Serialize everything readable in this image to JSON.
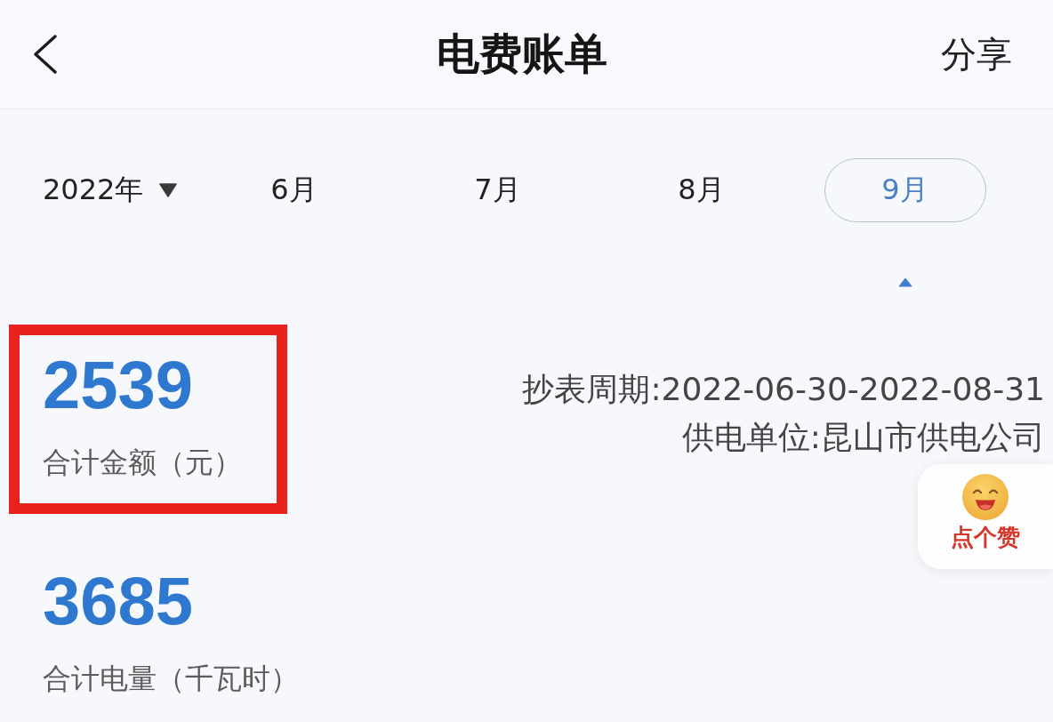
{
  "header": {
    "title": "电费账单",
    "action": "分享"
  },
  "period_selector": {
    "year": "2022年",
    "months": [
      {
        "label": "6月",
        "selected": false
      },
      {
        "label": "7月",
        "selected": false
      },
      {
        "label": "8月",
        "selected": false
      },
      {
        "label": "9月",
        "selected": true
      }
    ]
  },
  "summaries": [
    {
      "value": "2539",
      "label": "合计金额（元）",
      "highlighted": true
    },
    {
      "value": "3685",
      "label": "合计电量（千瓦时）",
      "highlighted": false
    }
  ],
  "details": [
    "抄表周期:2022-06-30-2022-08-31",
    "供电单位:昆山市供电公司"
  ],
  "like_badge": {
    "label": "点个赞"
  }
}
